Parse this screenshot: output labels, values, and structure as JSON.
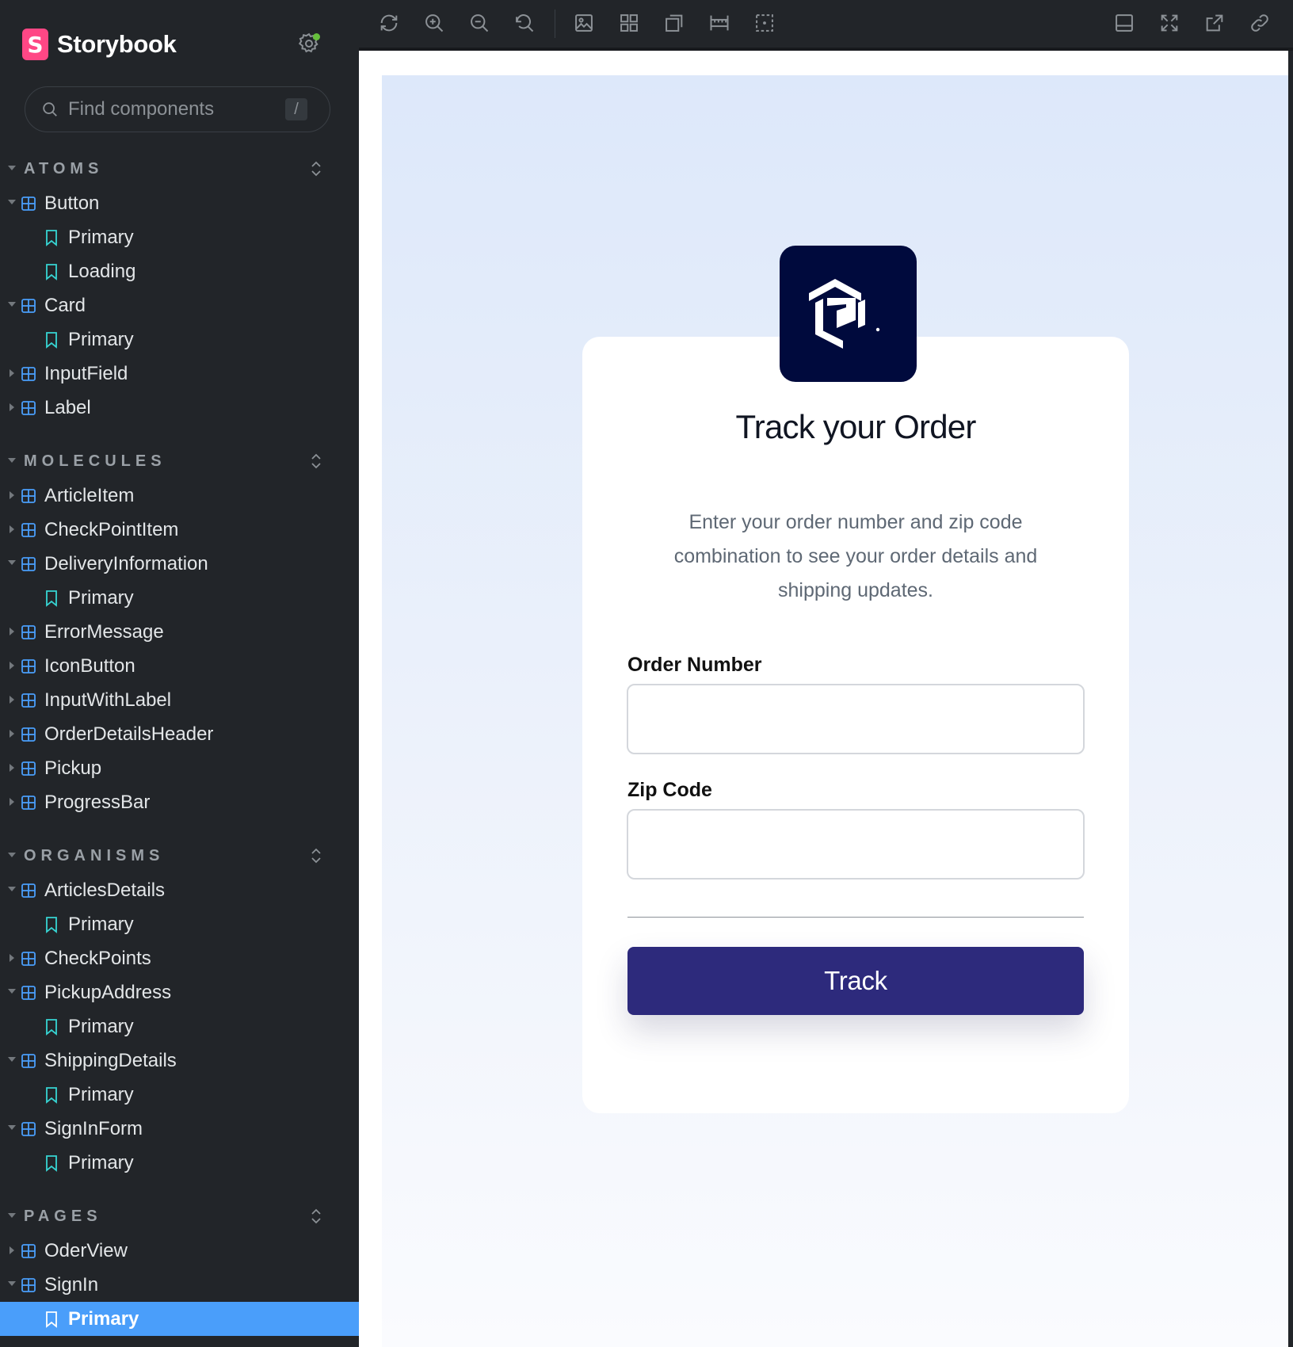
{
  "app": {
    "name": "Storybook"
  },
  "sidebar": {
    "search": {
      "placeholder": "Find components",
      "shortcut": "/"
    },
    "sections": [
      {
        "label": "ATOMS",
        "components": [
          {
            "label": "Button",
            "expanded": true,
            "stories": [
              "Primary",
              "Loading"
            ]
          },
          {
            "label": "Card",
            "expanded": true,
            "stories": [
              "Primary"
            ]
          },
          {
            "label": "InputField",
            "expanded": false,
            "stories": []
          },
          {
            "label": "Label",
            "expanded": false,
            "stories": []
          }
        ]
      },
      {
        "label": "MOLECULES",
        "components": [
          {
            "label": "ArticleItem",
            "expanded": false,
            "stories": []
          },
          {
            "label": "CheckPointItem",
            "expanded": false,
            "stories": []
          },
          {
            "label": "DeliveryInformation",
            "expanded": true,
            "stories": [
              "Primary"
            ]
          },
          {
            "label": "ErrorMessage",
            "expanded": false,
            "stories": []
          },
          {
            "label": "IconButton",
            "expanded": false,
            "stories": []
          },
          {
            "label": "InputWithLabel",
            "expanded": false,
            "stories": []
          },
          {
            "label": "OrderDetailsHeader",
            "expanded": false,
            "stories": []
          },
          {
            "label": "Pickup",
            "expanded": false,
            "stories": []
          },
          {
            "label": "ProgressBar",
            "expanded": false,
            "stories": []
          }
        ]
      },
      {
        "label": "ORGANISMS",
        "components": [
          {
            "label": "ArticlesDetails",
            "expanded": true,
            "stories": [
              "Primary"
            ]
          },
          {
            "label": "CheckPoints",
            "expanded": false,
            "stories": []
          },
          {
            "label": "PickupAddress",
            "expanded": true,
            "stories": [
              "Primary"
            ]
          },
          {
            "label": "ShippingDetails",
            "expanded": true,
            "stories": [
              "Primary"
            ]
          },
          {
            "label": "SignInForm",
            "expanded": true,
            "stories": [
              "Primary"
            ]
          }
        ]
      },
      {
        "label": "PAGES",
        "components": [
          {
            "label": "OderView",
            "expanded": false,
            "stories": []
          },
          {
            "label": "SignIn",
            "expanded": true,
            "stories": [
              "Primary"
            ]
          }
        ]
      }
    ],
    "selected_story": "PAGES/SignIn/Primary"
  },
  "toolbar": {
    "left_tools": [
      "reload-icon",
      "zoom-in-icon",
      "zoom-out-icon",
      "zoom-reset-icon",
      "image-icon",
      "grid-icon",
      "outline-icon",
      "ruler-icon",
      "measure-icon"
    ],
    "right_tools": [
      "panel-icon",
      "fullscreen-icon",
      "open-new-tab-icon",
      "link-icon"
    ]
  },
  "preview": {
    "title": "Track your Order",
    "description": "Enter your order number and zip code combination to see your order details and shipping updates.",
    "fields": [
      {
        "label": "Order Number",
        "value": ""
      },
      {
        "label": "Zip Code",
        "value": ""
      }
    ],
    "button_label": "Track",
    "colors": {
      "brand_bg": "#000a3d",
      "button_bg": "#2d2a7c",
      "stage_bg": "#dde8fa",
      "selection": "#4a9efa"
    }
  }
}
